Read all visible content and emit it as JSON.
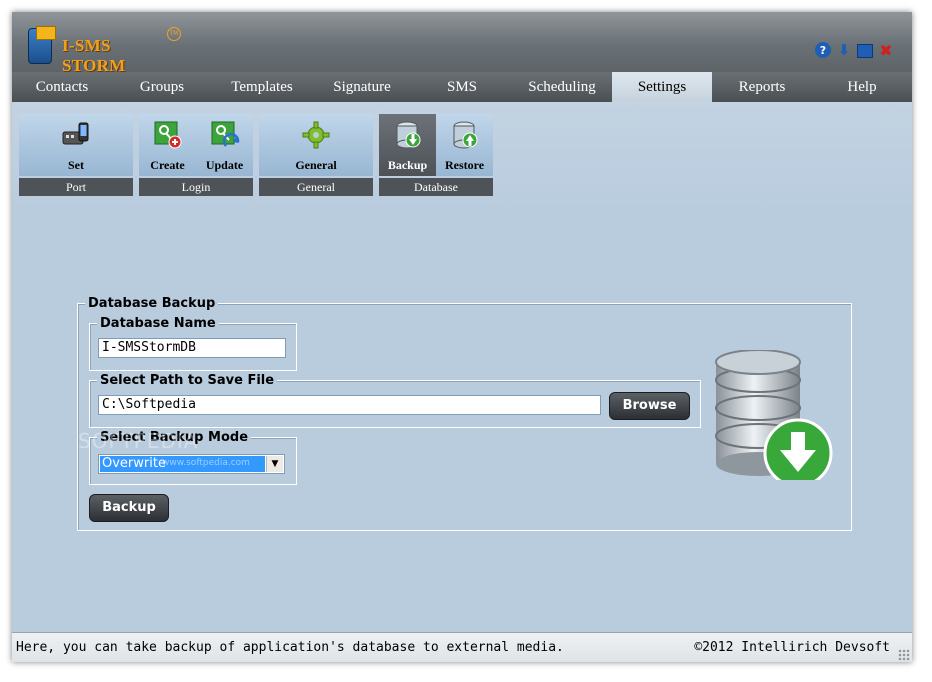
{
  "app": {
    "name": "I-SMS STORM",
    "tm": "TM"
  },
  "menu": {
    "items": [
      "Contacts",
      "Groups",
      "Templates",
      "Signature",
      "SMS",
      "Scheduling",
      "Settings",
      "Reports",
      "Help"
    ],
    "active": "Settings"
  },
  "ribbon": {
    "groups": [
      {
        "label": "Port",
        "buttons": [
          "Set"
        ]
      },
      {
        "label": "Login",
        "buttons": [
          "Create",
          "Update"
        ]
      },
      {
        "label": "General",
        "buttons": [
          "General"
        ]
      },
      {
        "label": "Database",
        "buttons": [
          "Backup",
          "Restore"
        ]
      }
    ]
  },
  "form": {
    "title": "Database Backup",
    "db_name_legend": "Database Name",
    "db_name_value": "I-SMSStormDB",
    "path_legend": "Select Path to Save File",
    "path_value": "C:\\Softpedia",
    "browse_label": "Browse",
    "mode_legend": "Select Backup Mode",
    "mode_value": "Overwrite",
    "backup_label": "Backup"
  },
  "watermark": {
    "main": "SOFTPEDIA",
    "sub": "www.softpedia.com"
  },
  "status": {
    "message": "Here, you can take backup of application's database to external media.",
    "copyright": "©2012 Intellirich Devsoft"
  },
  "colors": {
    "accent": "#3399ff",
    "status_bar_bg": "#dfe3e6",
    "menu_active_bg": "#c4d2dd"
  }
}
